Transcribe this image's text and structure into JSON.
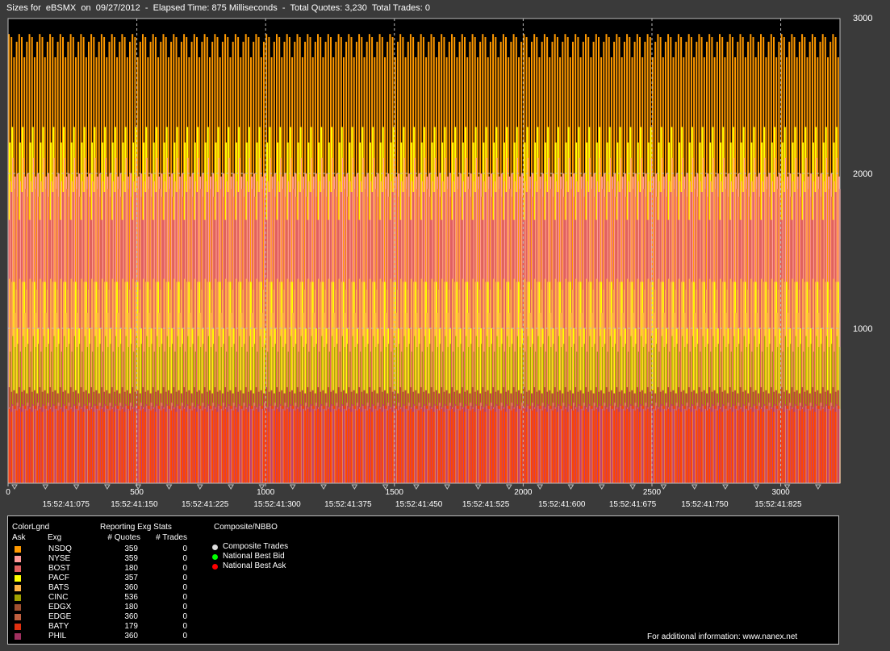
{
  "header": {
    "symbol_prefix": "Sizes for",
    "symbol": "eBSMX",
    "on_label": "on",
    "date": "09/27/2012",
    "elapsed_label": "Elapsed Time:",
    "elapsed": "875 Milliseconds",
    "quotes_label": "Total Quotes:",
    "quotes": "3,230",
    "trades_label": "Total Trades:",
    "trades": "0"
  },
  "chart_data": {
    "type": "bar",
    "title": "Sizes for eBSMX on 09/27/2012",
    "ylim": [
      0,
      3000
    ],
    "y_ticks": [
      "1000",
      "2000",
      "3000"
    ],
    "xlim": [
      0,
      3230
    ],
    "x_ticks": [
      "0",
      "500",
      "1000",
      "1500",
      "2000",
      "2500",
      "3000"
    ],
    "time_labels": [
      {
        "x": 225,
        "label": "15:52:41:075"
      },
      {
        "x": 490,
        "label": "15:52:41:150"
      },
      {
        "x": 765,
        "label": "15:52:41:225"
      },
      {
        "x": 1045,
        "label": "15:52:41:300"
      },
      {
        "x": 1320,
        "label": "15:52:41:375"
      },
      {
        "x": 1595,
        "label": "15:52:41:450"
      },
      {
        "x": 1855,
        "label": "15:52:41:525"
      },
      {
        "x": 2150,
        "label": "15:52:41:600"
      },
      {
        "x": 2425,
        "label": "15:52:41:675"
      },
      {
        "x": 2705,
        "label": "15:52:41:750"
      },
      {
        "x": 2990,
        "label": "15:52:41:825"
      }
    ],
    "series": [
      {
        "name": "NSDQ",
        "color": "#ff9900",
        "quotes": 359,
        "pattern_values": [
          2900,
          2880,
          2750,
          2850
        ]
      },
      {
        "name": "NYSE",
        "color": "#ff9a9a",
        "quotes": 359,
        "pattern_values": [
          2000,
          1950,
          2100,
          1980
        ]
      },
      {
        "name": "BOST",
        "color": "#e06060",
        "quotes": 180,
        "pattern_values": [
          1900,
          1850,
          1700,
          1880
        ]
      },
      {
        "name": "PACF",
        "color": "#ffff00",
        "quotes": 357,
        "pattern_values": [
          2300,
          1300,
          1000,
          2200
        ]
      },
      {
        "name": "BATS",
        "color": "#ffb347",
        "quotes": 360,
        "pattern_values": [
          1320,
          1300,
          1100,
          1250
        ]
      },
      {
        "name": "CINC",
        "color": "#a0a000",
        "quotes": 536,
        "pattern_values": [
          900,
          850,
          950,
          880
        ]
      },
      {
        "name": "EDGX",
        "color": "#c04040",
        "quotes": 180,
        "pattern_values": [
          600,
          580,
          620,
          590
        ]
      },
      {
        "name": "EDGE",
        "color": "#e08060",
        "quotes": 360,
        "pattern_values": [
          500,
          480,
          520,
          490
        ]
      },
      {
        "name": "BATY",
        "color": "#ff4400",
        "quotes": 179,
        "pattern_values": [
          480,
          460,
          500,
          470
        ]
      },
      {
        "name": "PHIL",
        "color": "#c04070",
        "quotes": 360,
        "pattern_values": [
          500,
          490,
          510,
          480
        ]
      }
    ]
  },
  "legend": {
    "color_legend_label": "ColorLgnd",
    "ask_label": "Ask",
    "exg_label": "Exg",
    "stats_label": "Reporting Exg Stats",
    "quotes_col": "# Quotes",
    "trades_col": "# Trades",
    "composite_label": "Composite/NBBO",
    "rows": [
      {
        "exg": "NSDQ",
        "quotes": "359",
        "trades": "0",
        "color": "#ff9900"
      },
      {
        "exg": "NYSE",
        "quotes": "359",
        "trades": "0",
        "color": "#ff9a9a"
      },
      {
        "exg": "BOST",
        "quotes": "180",
        "trades": "0",
        "color": "#e06060"
      },
      {
        "exg": "PACF",
        "quotes": "357",
        "trades": "0",
        "color": "#ffff00"
      },
      {
        "exg": "BATS",
        "quotes": "360",
        "trades": "0",
        "color": "#ffb347"
      },
      {
        "exg": "CINC",
        "quotes": "536",
        "trades": "0",
        "color": "#a0a000"
      },
      {
        "exg": "EDGX",
        "quotes": "180",
        "trades": "0",
        "color": "#a05030"
      },
      {
        "exg": "EDGE",
        "quotes": "360",
        "trades": "0",
        "color": "#c06040"
      },
      {
        "exg": "BATY",
        "quotes": "179",
        "trades": "0",
        "color": "#e03010"
      },
      {
        "exg": "PHIL",
        "quotes": "360",
        "trades": "0",
        "color": "#a03060"
      }
    ],
    "composite_items": [
      {
        "label": "Composite Trades",
        "color": "#dddddd"
      },
      {
        "label": "National Best Bid",
        "color": "#00ff00"
      },
      {
        "label": "National Best Ask",
        "color": "#ff0000"
      }
    ],
    "footer": "For additional information: www.nanex.net"
  }
}
